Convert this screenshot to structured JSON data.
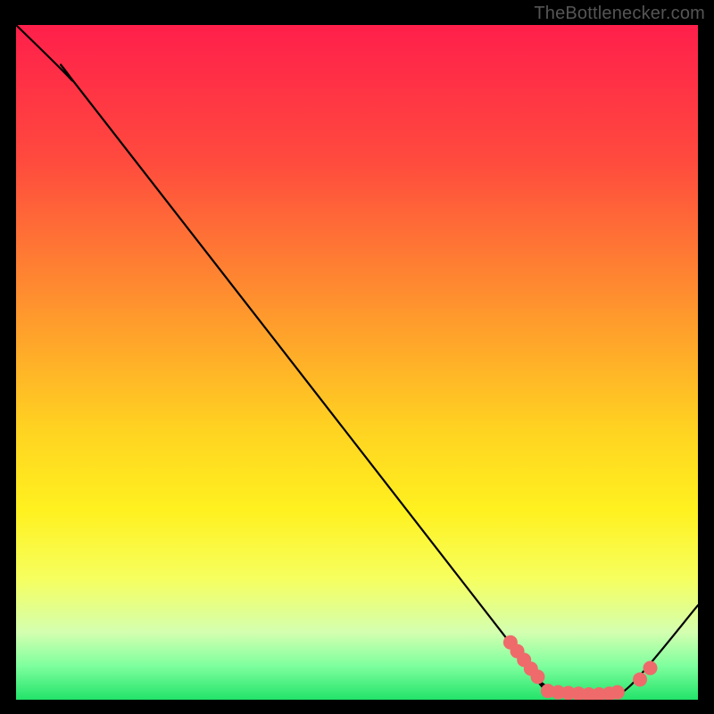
{
  "watermark": "TheBottlenecker.com",
  "chart_data": {
    "type": "line",
    "title": "",
    "xlabel": "",
    "ylabel": "",
    "xlim": [
      0,
      100
    ],
    "ylim": [
      0,
      100
    ],
    "background_gradient": {
      "stops": [
        {
          "offset": 0.0,
          "color": "#ff1f4b"
        },
        {
          "offset": 0.2,
          "color": "#ff4a3e"
        },
        {
          "offset": 0.4,
          "color": "#ff8e2f"
        },
        {
          "offset": 0.6,
          "color": "#ffd321"
        },
        {
          "offset": 0.72,
          "color": "#fff120"
        },
        {
          "offset": 0.82,
          "color": "#f6ff5e"
        },
        {
          "offset": 0.9,
          "color": "#d4ffb0"
        },
        {
          "offset": 0.95,
          "color": "#7eff9e"
        },
        {
          "offset": 1.0,
          "color": "#22e36a"
        }
      ]
    },
    "curve": [
      {
        "x": 0,
        "y": 100
      },
      {
        "x": 8,
        "y": 92
      },
      {
        "x": 12,
        "y": 87
      },
      {
        "x": 72,
        "y": 9
      },
      {
        "x": 76,
        "y": 3.5
      },
      {
        "x": 80,
        "y": 1.0
      },
      {
        "x": 86,
        "y": 0.8
      },
      {
        "x": 90,
        "y": 2.0
      },
      {
        "x": 100,
        "y": 14
      }
    ],
    "marker_points": [
      {
        "x": 72.5,
        "y": 8.5
      },
      {
        "x": 73.5,
        "y": 7.2
      },
      {
        "x": 74.5,
        "y": 5.9
      },
      {
        "x": 75.5,
        "y": 4.6
      },
      {
        "x": 76.5,
        "y": 3.4
      },
      {
        "x": 78.0,
        "y": 1.3
      },
      {
        "x": 79.5,
        "y": 1.1
      },
      {
        "x": 81.0,
        "y": 1.0
      },
      {
        "x": 82.5,
        "y": 0.9
      },
      {
        "x": 84.0,
        "y": 0.8
      },
      {
        "x": 85.5,
        "y": 0.8
      },
      {
        "x": 87.0,
        "y": 0.9
      },
      {
        "x": 88.2,
        "y": 1.1
      },
      {
        "x": 91.5,
        "y": 3.0
      },
      {
        "x": 93.0,
        "y": 4.7
      }
    ],
    "marker_color": "#ef6a6b",
    "marker_radius": 8,
    "line_color": "#000000",
    "line_width": 2.2
  }
}
